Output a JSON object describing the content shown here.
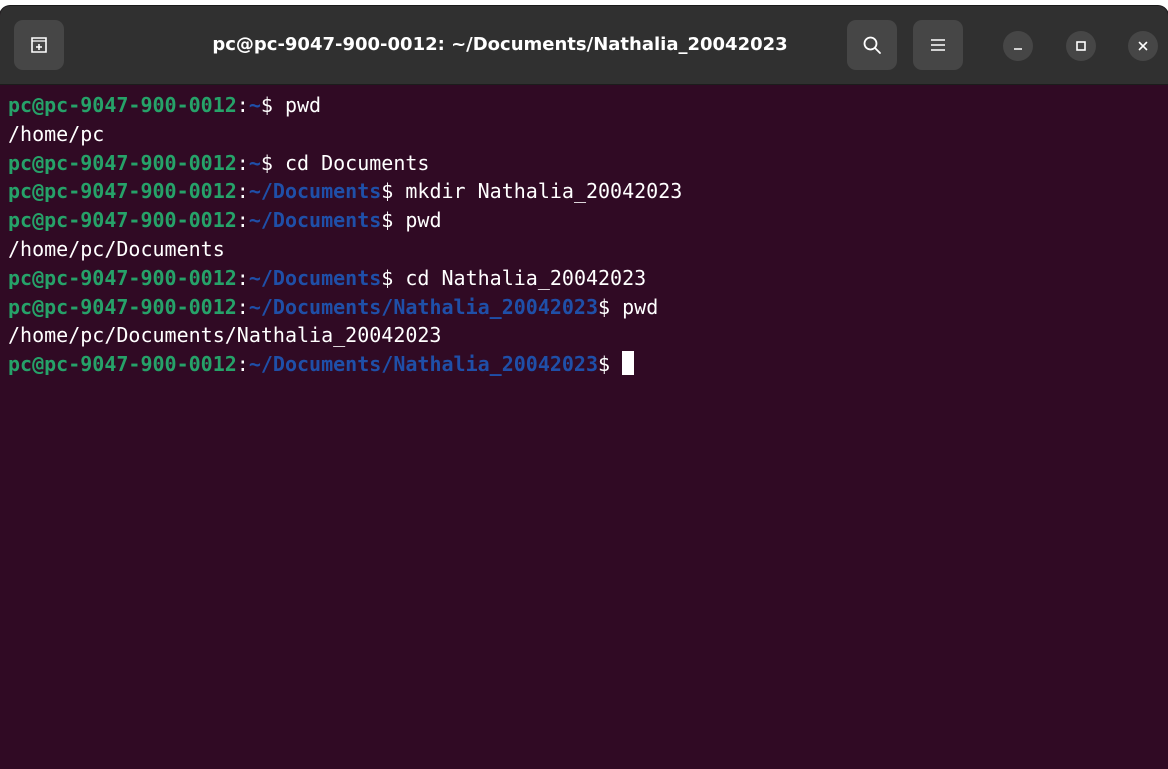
{
  "window": {
    "title": "pc@pc-9047-900-0012: ~/Documents/Nathalia_20042023"
  },
  "titlebar": {
    "new_tab_icon": "new-tab-icon",
    "search_icon": "search-icon",
    "menu_icon": "hamburger-menu-icon",
    "minimize_icon": "minimize-icon",
    "maximize_icon": "maximize-icon",
    "close_icon": "close-icon"
  },
  "colors": {
    "terminal_bg": "#300a24",
    "titlebar_bg": "#303030",
    "prompt_user": "#26a269",
    "prompt_path": "#1f4fa8",
    "text": "#ffffff"
  },
  "terminal": {
    "lines": [
      {
        "kind": "prompt",
        "user": "pc@pc-9047-900-0012",
        "colon": ":",
        "path": "~",
        "cmd": "$ pwd"
      },
      {
        "kind": "output",
        "text": "/home/pc"
      },
      {
        "kind": "prompt",
        "user": "pc@pc-9047-900-0012",
        "colon": ":",
        "path": "~",
        "cmd": "$ cd Documents"
      },
      {
        "kind": "prompt",
        "user": "pc@pc-9047-900-0012",
        "colon": ":",
        "path": "~/Documents",
        "cmd": "$ mkdir Nathalia_20042023"
      },
      {
        "kind": "prompt",
        "user": "pc@pc-9047-900-0012",
        "colon": ":",
        "path": "~/Documents",
        "cmd": "$ pwd"
      },
      {
        "kind": "output",
        "text": "/home/pc/Documents"
      },
      {
        "kind": "prompt",
        "user": "pc@pc-9047-900-0012",
        "colon": ":",
        "path": "~/Documents",
        "cmd": "$ cd Nathalia_20042023"
      },
      {
        "kind": "prompt",
        "user": "pc@pc-9047-900-0012",
        "colon": ":",
        "path": "~/Documents/Nathalia_20042023",
        "cmd": "$ pwd"
      },
      {
        "kind": "output",
        "text": "/home/pc/Documents/Nathalia_20042023"
      },
      {
        "kind": "prompt",
        "user": "pc@pc-9047-900-0012",
        "colon": ":",
        "path": "~/Documents/Nathalia_20042023",
        "cmd": "$ ",
        "cursor": true
      }
    ]
  }
}
